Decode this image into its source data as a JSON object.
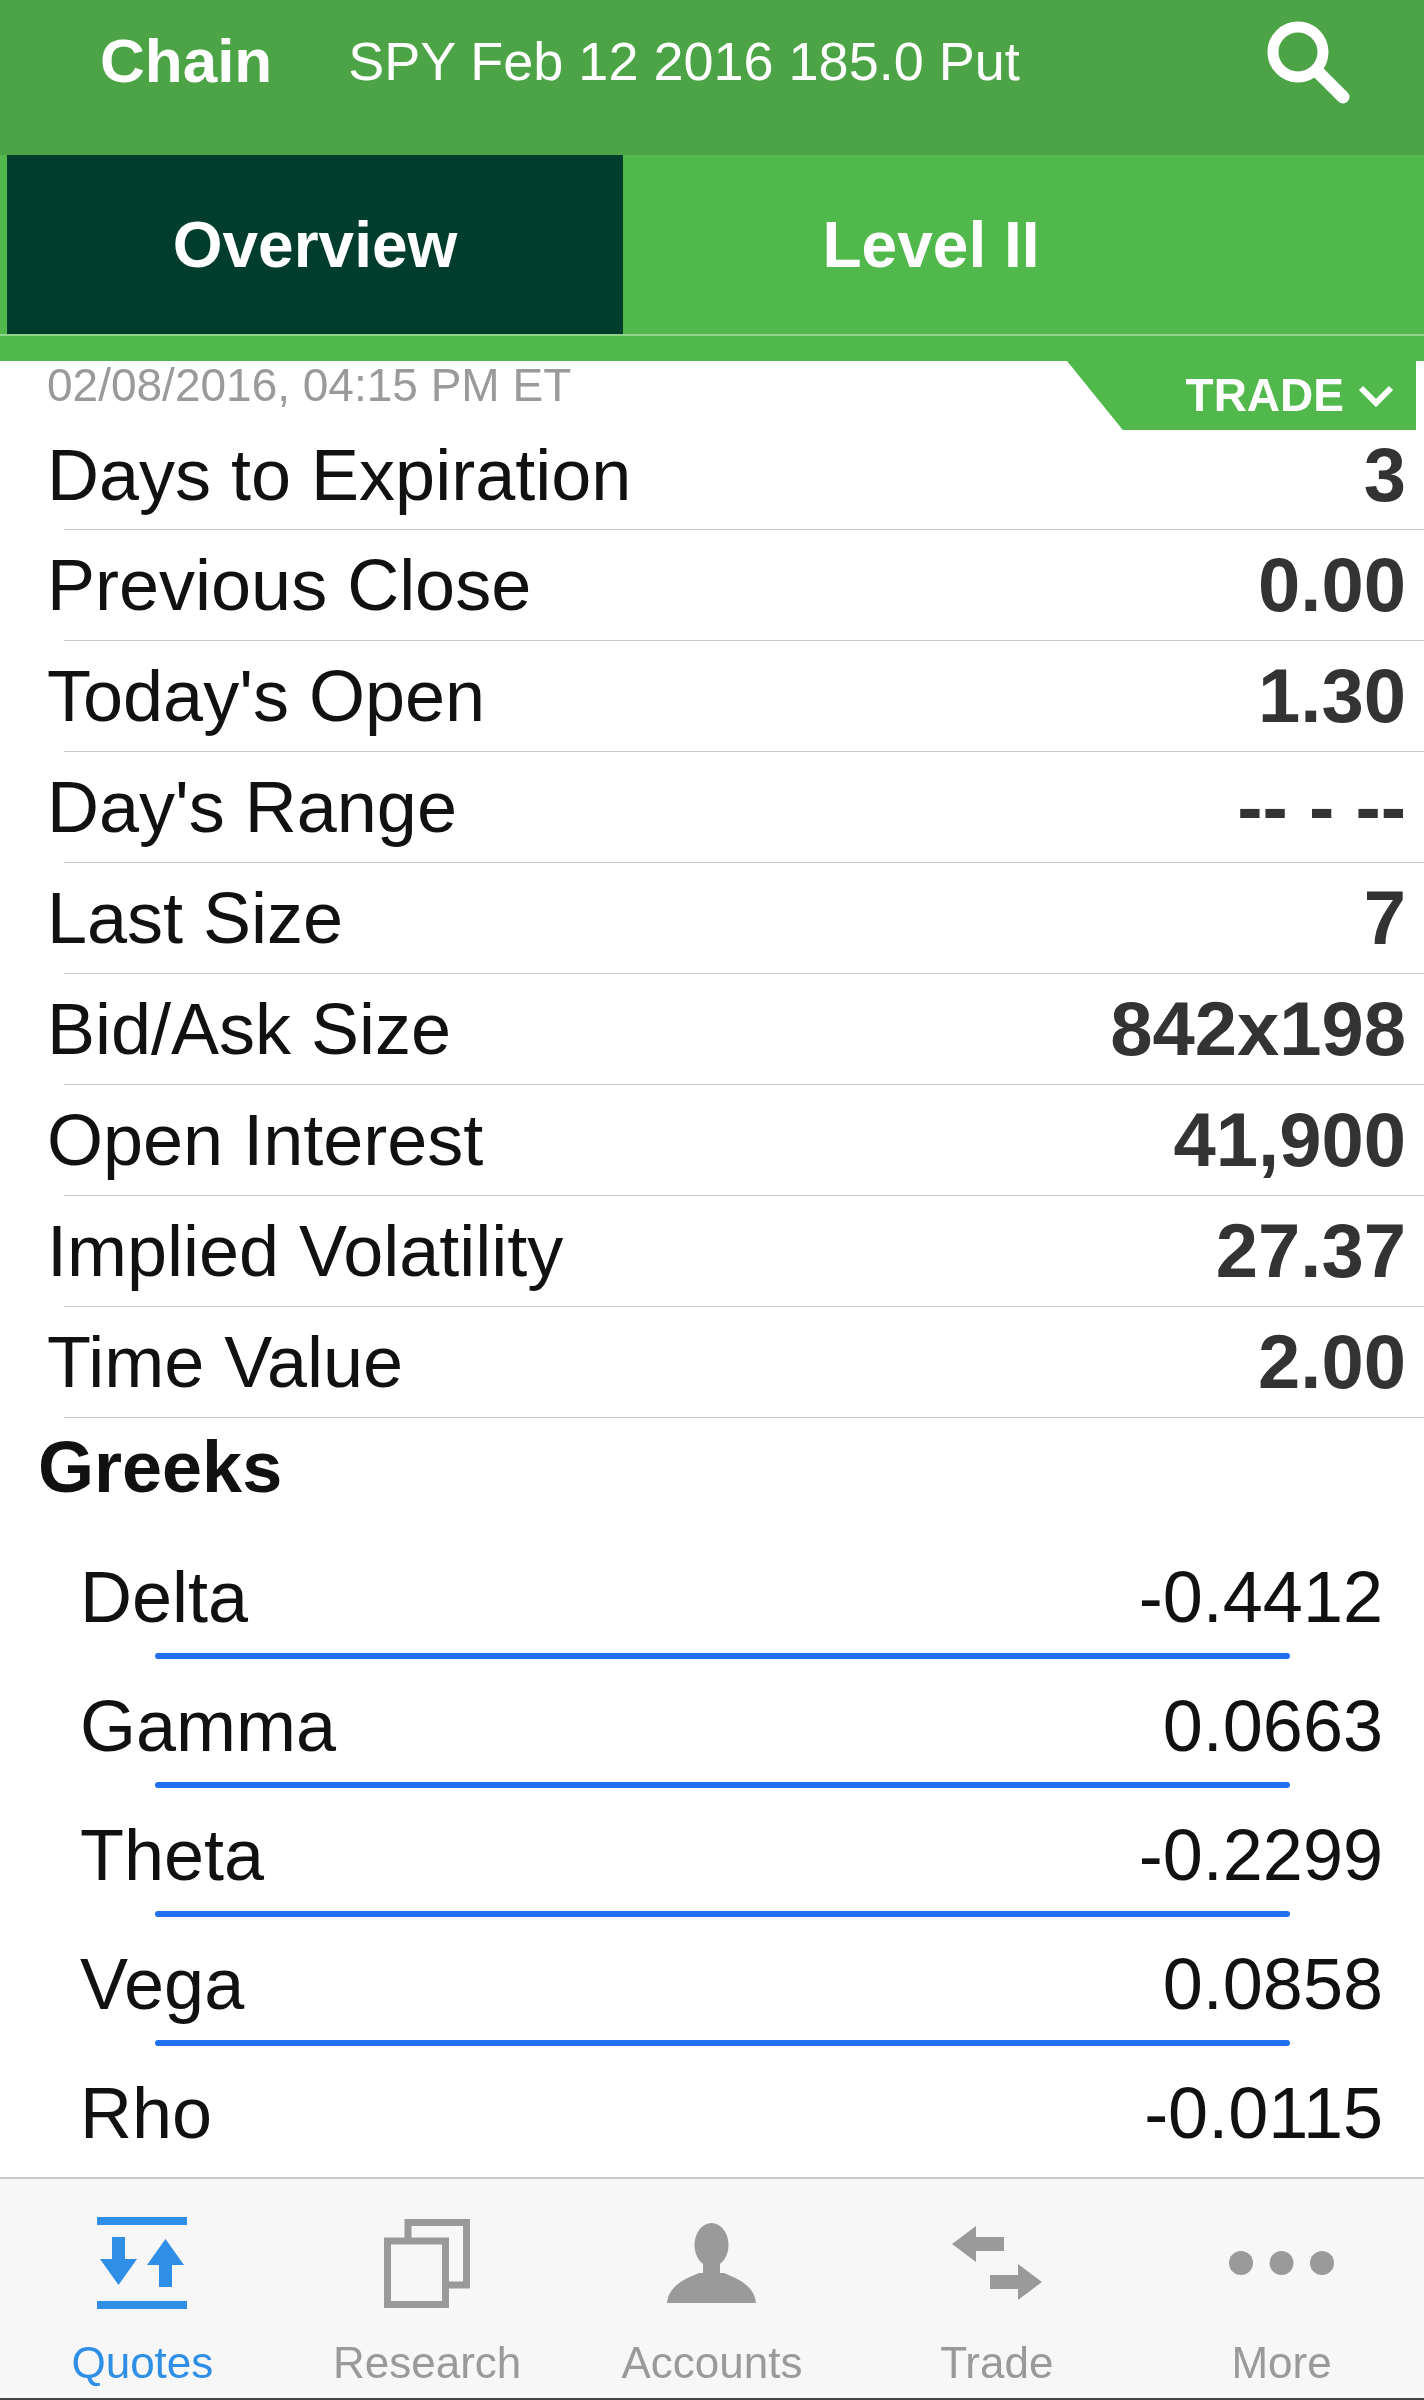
{
  "header": {
    "title": "Chain",
    "subtitle": "SPY Feb 12 2016 185.0 Put"
  },
  "tabs": [
    {
      "label": "Overview",
      "selected": true
    },
    {
      "label": "Level II",
      "selected": false
    }
  ],
  "timestamp": "02/08/2016, 04:15 PM ET",
  "trade_button": {
    "label": "TRADE"
  },
  "quote_rows": [
    {
      "label": "Days to Expiration",
      "value": "3"
    },
    {
      "label": "Previous Close",
      "value": "0.00"
    },
    {
      "label": "Today's Open",
      "value": "1.30"
    },
    {
      "label": "Day's Range",
      "value": "-- - --"
    },
    {
      "label": "Last Size",
      "value": "7"
    },
    {
      "label": "Bid/Ask Size",
      "value": "842x198"
    },
    {
      "label": "Open Interest",
      "value": "41,900"
    },
    {
      "label": "Implied Volatility",
      "value": "27.37"
    },
    {
      "label": "Time Value",
      "value": "2.00"
    }
  ],
  "greeks": {
    "title": "Greeks",
    "rows": [
      {
        "label": "Delta",
        "value": "-0.4412"
      },
      {
        "label": "Gamma",
        "value": "0.0663"
      },
      {
        "label": "Theta",
        "value": "-0.2299"
      },
      {
        "label": "Vega",
        "value": "0.0858"
      },
      {
        "label": "Rho",
        "value": "-0.0115"
      }
    ]
  },
  "tab_bar": [
    {
      "label": "Quotes",
      "selected": true
    },
    {
      "label": "Research",
      "selected": false
    },
    {
      "label": "Accounts",
      "selected": false
    },
    {
      "label": "Trade",
      "selected": false
    },
    {
      "label": "More",
      "selected": false
    }
  ]
}
